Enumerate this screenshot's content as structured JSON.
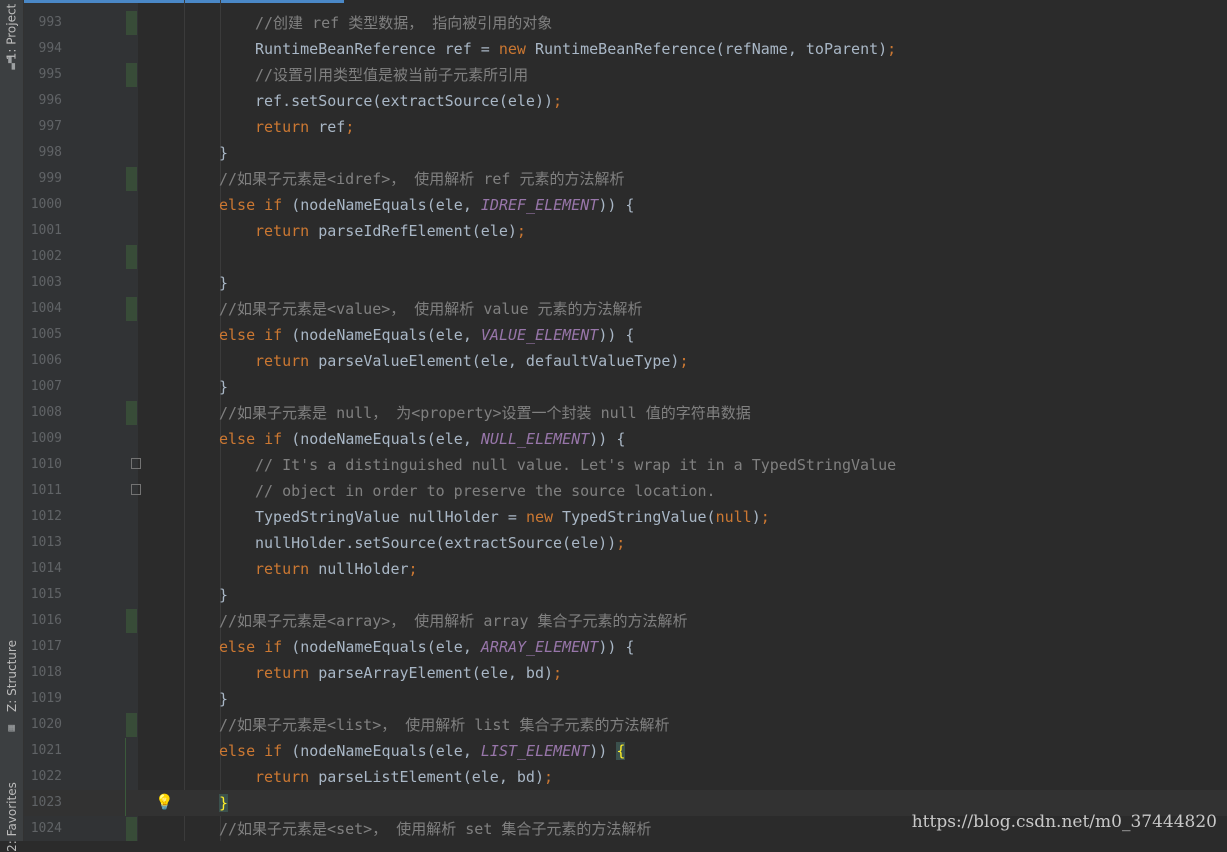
{
  "tool_windows": {
    "project_tab": "1: Project",
    "structure_tab": "Z: Structure",
    "favorites_tab": "2: Favorites"
  },
  "icons": {
    "project": "folder-icon",
    "structure": "structure-icon",
    "favorites": "star-icon",
    "intention": "lightbulb-icon"
  },
  "colors": {
    "keyword": "#cc7832",
    "comment": "#808080",
    "constant": "#9876aa",
    "text": "#a9b7c6",
    "line_number": "#606366",
    "brace_highlight": "#ffef28"
  },
  "editor": {
    "current_line": "1023",
    "lines": [
      {
        "number": "993"
      },
      {
        "number": "994"
      },
      {
        "number": "995"
      },
      {
        "number": "996"
      },
      {
        "number": "997"
      },
      {
        "number": "998"
      },
      {
        "number": "999"
      },
      {
        "number": "1000"
      },
      {
        "number": "1001"
      },
      {
        "number": "1002"
      },
      {
        "number": "1003"
      },
      {
        "number": "1004"
      },
      {
        "number": "1005"
      },
      {
        "number": "1006"
      },
      {
        "number": "1007"
      },
      {
        "number": "1008"
      },
      {
        "number": "1009"
      },
      {
        "number": "1010"
      },
      {
        "number": "1011"
      },
      {
        "number": "1012"
      },
      {
        "number": "1013"
      },
      {
        "number": "1014"
      },
      {
        "number": "1015"
      },
      {
        "number": "1016"
      },
      {
        "number": "1017"
      },
      {
        "number": "1018"
      },
      {
        "number": "1019"
      },
      {
        "number": "1020"
      },
      {
        "number": "1021"
      },
      {
        "number": "1022"
      },
      {
        "number": "1023"
      },
      {
        "number": "1024"
      }
    ],
    "tokens": {
      "l993": "//创建 ref 类型数据， 指向被引用的对象",
      "l994_a": "RuntimeBeanReference ref = ",
      "l994_kw": "new",
      "l994_b": " RuntimeBeanReference(refName, toParent)",
      "l994_semi": ";",
      "l995": "//设置引用类型值是被当前子元素所引用",
      "l996_a": "ref.setSource(extractSource(ele))",
      "l996_semi": ";",
      "l997_kw": "return",
      "l997_b": " ref",
      "l997_semi": ";",
      "l998": "}",
      "l999": "//如果子元素是<idref>， 使用解析 ref 元素的方法解析",
      "l1000_kw": "else if",
      "l1000_a": " (nodeNameEquals(ele, ",
      "l1000_c": "IDREF_ELEMENT",
      "l1000_b": ")) {",
      "l1001_kw": "return",
      "l1001_b": " parseIdRefElement(ele)",
      "l1001_semi": ";",
      "l1003": "}",
      "l1004": "//如果子元素是<value>， 使用解析 value 元素的方法解析",
      "l1005_kw": "else if",
      "l1005_a": " (nodeNameEquals(ele, ",
      "l1005_c": "VALUE_ELEMENT",
      "l1005_b": ")) {",
      "l1006_kw": "return",
      "l1006_b": " parseValueElement(ele, defaultValueType)",
      "l1006_semi": ";",
      "l1007": "}",
      "l1008": "//如果子元素是 null， 为<property>设置一个封装 null 值的字符串数据",
      "l1009_kw": "else if",
      "l1009_a": " (nodeNameEquals(ele, ",
      "l1009_c": "NULL_ELEMENT",
      "l1009_b": ")) {",
      "l1010": "// It's a distinguished null value. Let's wrap it in a TypedStringValue",
      "l1011": "// object in order to preserve the source location.",
      "l1012_a": "TypedStringValue nullHolder = ",
      "l1012_kw": "new",
      "l1012_b": " TypedStringValue(",
      "l1012_kw2": "null",
      "l1012_c": ")",
      "l1012_semi": ";",
      "l1013_a": "nullHolder.setSource(extractSource(ele))",
      "l1013_semi": ";",
      "l1014_kw": "return",
      "l1014_b": " nullHolder",
      "l1014_semi": ";",
      "l1015": "}",
      "l1016": "//如果子元素是<array>， 使用解析 array 集合子元素的方法解析",
      "l1017_kw": "else if",
      "l1017_a": " (nodeNameEquals(ele, ",
      "l1017_c": "ARRAY_ELEMENT",
      "l1017_b": ")) {",
      "l1018_kw": "return",
      "l1018_b": " parseArrayElement(ele, bd)",
      "l1018_semi": ";",
      "l1019": "}",
      "l1020": "//如果子元素是<list>， 使用解析 list 集合子元素的方法解析",
      "l1021_kw": "else if",
      "l1021_a": " (nodeNameEquals(ele, ",
      "l1021_c": "LIST_ELEMENT",
      "l1021_b": ")) ",
      "l1021_brace": "{",
      "l1022_kw": "return",
      "l1022_b": " parseListElement(ele, bd)",
      "l1022_semi": ";",
      "l1023_brace": "}",
      "l1024": "//如果子元素是<set>， 使用解析 set 集合子元素的方法解析"
    }
  },
  "watermark": "https://blog.csdn.net/m0_37444820"
}
